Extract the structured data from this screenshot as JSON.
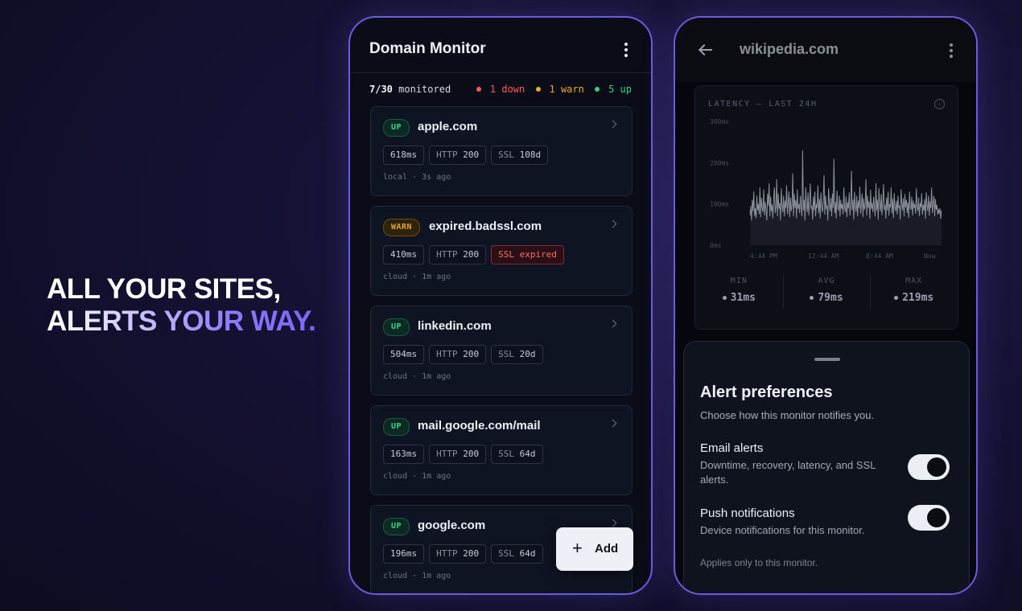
{
  "hero": {
    "line1": "ALL YOUR SITES,",
    "line2": "ALERTS YOUR WAY."
  },
  "monitor": {
    "title": "Domain Monitor",
    "summary": {
      "count": "7/30",
      "count_label": "monitored",
      "down": "1 down",
      "warn": "1 warn",
      "up": "5 up"
    },
    "colors": {
      "down": "#ff5a5f",
      "warn": "#f0a830",
      "up": "#30d17f"
    },
    "sites": [
      {
        "status": "UP",
        "domain": "apple.com",
        "latency": "618ms",
        "http_label": "HTTP",
        "http": "200",
        "ssl_label": "SSL",
        "ssl": "108d",
        "meta": "local · 3s ago"
      },
      {
        "status": "WARN",
        "domain": "expired.badssl.com",
        "latency": "410ms",
        "http_label": "HTTP",
        "http": "200",
        "ssl_label": "SSL",
        "ssl": "expired",
        "meta": "cloud · 1m ago"
      },
      {
        "status": "UP",
        "domain": "linkedin.com",
        "latency": "504ms",
        "http_label": "HTTP",
        "http": "200",
        "ssl_label": "SSL",
        "ssl": "20d",
        "meta": "cloud · 1m ago"
      },
      {
        "status": "UP",
        "domain": "mail.google.com/mail",
        "latency": "163ms",
        "http_label": "HTTP",
        "http": "200",
        "ssl_label": "SSL",
        "ssl": "64d",
        "meta": "cloud · 1m ago"
      },
      {
        "status": "UP",
        "domain": "google.com",
        "latency": "196ms",
        "http_label": "HTTP",
        "http": "200",
        "ssl_label": "SSL",
        "ssl": "64d",
        "meta": "cloud · 1m ago"
      }
    ],
    "add_button": {
      "icon": "plus-icon",
      "label": "Add"
    }
  },
  "detail": {
    "title": "wikipedia.com",
    "latency_title": "LATENCY — LAST 24H",
    "stats": [
      {
        "label": "MIN",
        "value": "31ms"
      },
      {
        "label": "AVG",
        "value": "79ms"
      },
      {
        "label": "MAX",
        "value": "219ms"
      }
    ]
  },
  "chart_data": {
    "type": "line",
    "title": "LATENCY — LAST 24H",
    "xlabel": "",
    "ylabel": "",
    "y_ticks": [
      "300ms",
      "200ms",
      "100ms",
      "0ms"
    ],
    "x_ticks": [
      "4:44 PM",
      "12:44 AM",
      "8:44 AM",
      "Now"
    ],
    "ylim": [
      0,
      300
    ],
    "series": [
      {
        "values": [
          72,
          95,
          60,
          110,
          82,
          130,
          70,
          90,
          65,
          120,
          85,
          100,
          75,
          140,
          68,
          115,
          90,
          80,
          135,
          72,
          105,
          88,
          60,
          125,
          95,
          150,
          70,
          118,
          82,
          98,
          65,
          112,
          140,
          78,
          92,
          160,
          70,
          125,
          88,
          102,
          60,
          138,
          95,
          80,
          120,
          70,
          108,
          90,
          145,
          75,
          100,
          130,
          68,
          115,
          82,
          96,
          175,
          70,
          125,
          90,
          110,
          65,
          135,
          88,
          100,
          78,
          120,
          92,
          70,
          230,
          85,
          110,
          60,
          140,
          95,
          80,
          128,
          72,
          105,
          150,
          88,
          96,
          62,
          118,
          84,
          130,
          70,
          100,
          90,
          145,
          78,
          112,
          65,
          128,
          92,
          80,
          108,
          170,
          74,
          120,
          88,
          96,
          60,
          138,
          100,
          82,
          115,
          70,
          125,
          90,
          210,
          78,
          105,
          65,
          132,
          92,
          84,
          120,
          70,
          110,
          88,
          100,
          75,
          140,
          92,
          80,
          118,
          68,
          104,
          90,
          128,
          72,
          96,
          180,
          85,
          110,
          62,
          130,
          95,
          80,
          120,
          70,
          108,
          90,
          142,
          76,
          100,
          125,
          68,
          114,
          86,
          96,
          160,
          72,
          120,
          90,
          106,
          64,
          134,
          88,
          102,
          80,
          118,
          94,
          70,
          150,
          84,
          110,
          62,
          138,
          96,
          82,
          124,
          72,
          104,
          148,
          86,
          98,
          64,
          116,
          84,
          130,
          72,
          100,
          92,
          140,
          78,
          112,
          66,
          126,
          92,
          82,
          108,
          74,
          120,
          90,
          96,
          62,
          136,
          100,
          84,
          114,
          70,
          124,
          92,
          110,
          78,
          104,
          66,
          130,
          92,
          86,
          118,
          72,
          108,
          90,
          100,
          76,
          138,
          94,
          82,
          116,
          70,
          102,
          92,
          126,
          74,
          98,
          84,
          112,
          64,
          128,
          96,
          82,
          120,
          72,
          106,
          90,
          140,
          78,
          102,
          120,
          70,
          112,
          86,
          98,
          74,
          88,
          76,
          90,
          64,
          84
        ]
      }
    ]
  },
  "prefs": {
    "title": "Alert preferences",
    "subtitle": "Choose how this monitor notifies you.",
    "email": {
      "title": "Email alerts",
      "desc": "Downtime, recovery, latency, and SSL alerts.",
      "enabled": true
    },
    "push": {
      "title": "Push notifications",
      "desc": "Device notifications for this monitor.",
      "enabled": true
    },
    "footnote": "Applies only to this monitor."
  }
}
